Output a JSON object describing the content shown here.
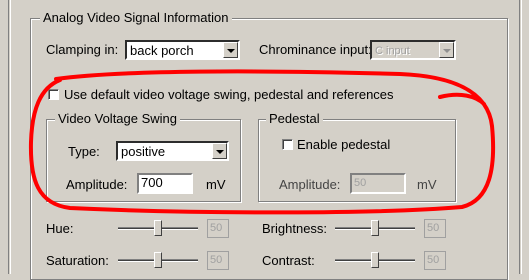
{
  "group_title": "Analog Video Signal Information",
  "clamping": {
    "label": "Clamping in:",
    "value": "back porch"
  },
  "chrominance": {
    "label": "Chrominance input:",
    "value": "C input"
  },
  "use_default": {
    "label": "Use default video voltage swing, pedestal and references",
    "checked": false
  },
  "voltage_swing": {
    "title": "Video Voltage Swing",
    "type_label": "Type:",
    "type_value": "positive",
    "amplitude_label": "Amplitude:",
    "amplitude_value": "700",
    "unit": "mV"
  },
  "pedestal": {
    "title": "Pedestal",
    "enable_label": "Enable pedestal",
    "enable_checked": false,
    "amplitude_label": "Amplitude:",
    "amplitude_value": "50",
    "unit": "mV"
  },
  "sliders": {
    "hue": {
      "label": "Hue:",
      "value": "50",
      "position": 0.5
    },
    "brightness": {
      "label": "Brightness:",
      "value": "50",
      "position": 0.5
    },
    "saturation": {
      "label": "Saturation:",
      "value": "50",
      "position": 0.5
    },
    "contrast": {
      "label": "Contrast:",
      "value": "50",
      "position": 0.5
    }
  },
  "colors": {
    "annotation": "#ff0000",
    "dialog_bg": "#d4d0c8"
  }
}
